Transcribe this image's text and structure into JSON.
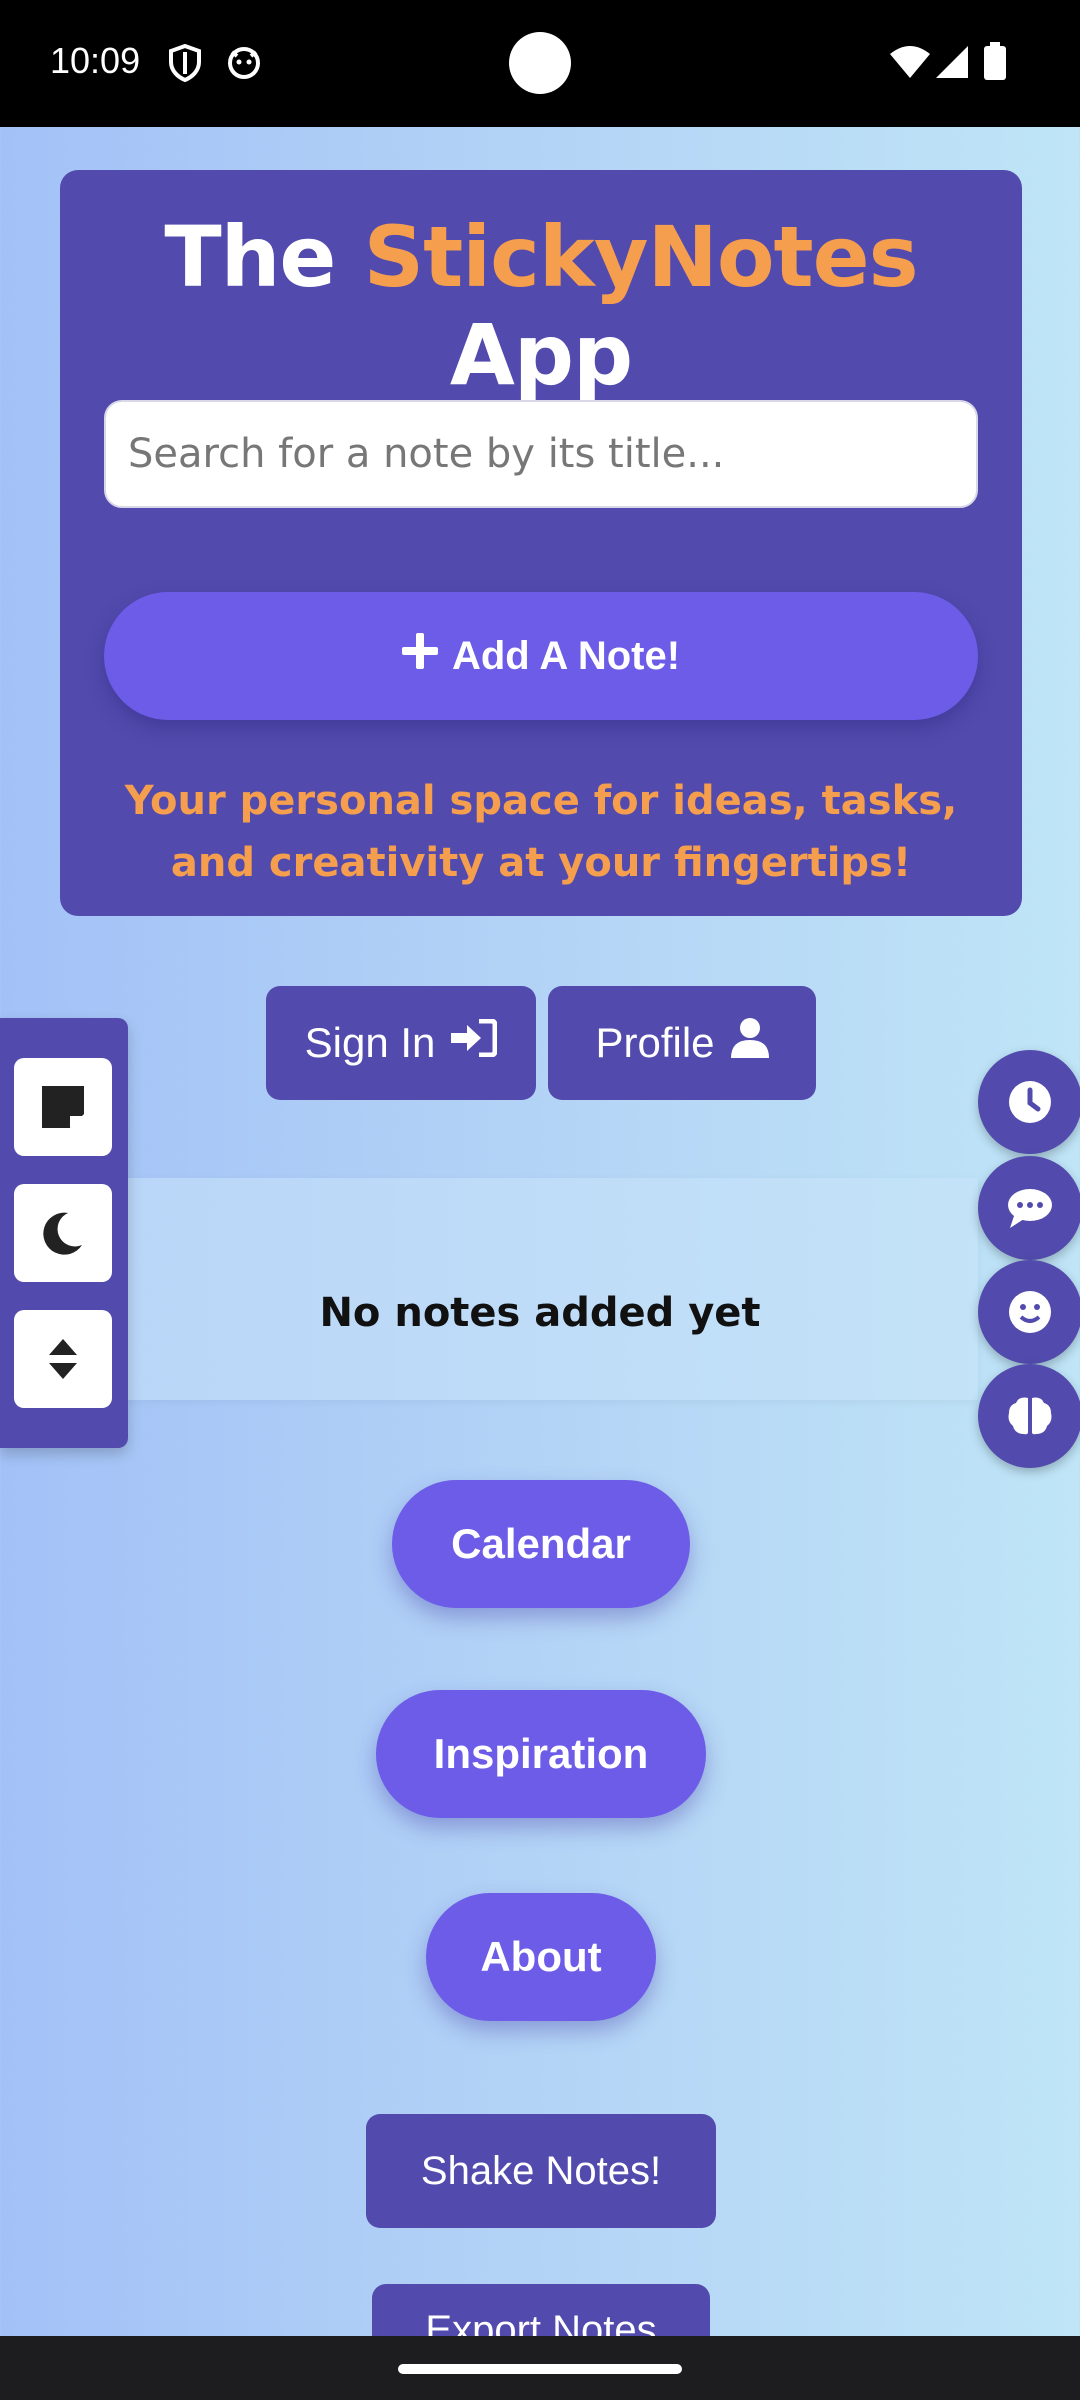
{
  "status_bar": {
    "time": "10:09",
    "left_icons": [
      "shield-icon",
      "cat-icon"
    ],
    "right_icons": [
      "wifi-icon",
      "signal-icon",
      "battery-icon"
    ]
  },
  "header": {
    "title_prefix": "The ",
    "title_accent": "StickyNotes",
    "title_suffix": " App",
    "search_placeholder": "Search for a note by its title...",
    "add_note_label": "Add A Note!",
    "tagline": "Your personal space for ideas, tasks, and creativity at your fingertips!"
  },
  "auth": {
    "sign_in_label": "Sign In",
    "profile_label": "Profile"
  },
  "left_panel": {
    "items": [
      "sticky-note-icon",
      "moon-icon",
      "sort-icon"
    ]
  },
  "right_fabs": {
    "items": [
      "clock-icon",
      "chat-icon",
      "smile-icon",
      "brain-icon"
    ]
  },
  "notes": {
    "empty_message": "No notes added yet"
  },
  "nav_buttons": {
    "calendar": "Calendar",
    "inspiration": "Inspiration",
    "about": "About",
    "shake": "Shake Notes!",
    "export": "Export Notes"
  },
  "colors": {
    "primary": "#524bad",
    "button": "#6c5ce7",
    "accent": "#f59e4e"
  }
}
